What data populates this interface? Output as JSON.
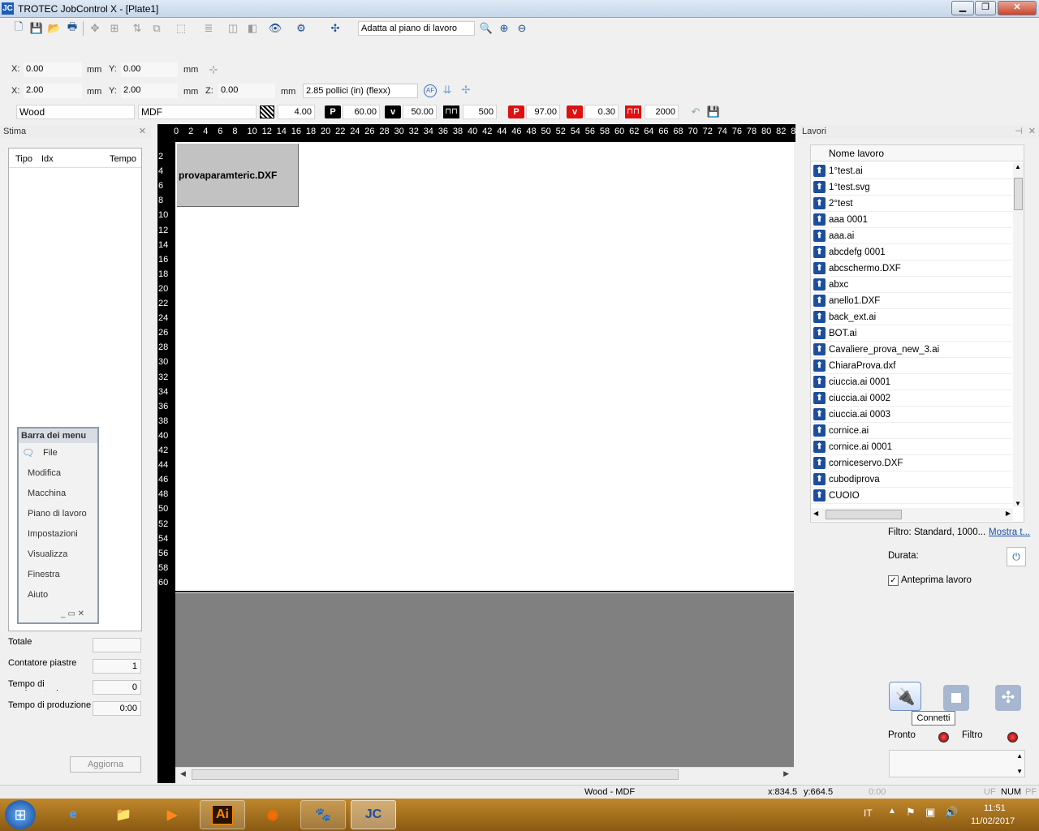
{
  "window": {
    "title": "TROTEC JobControl X - [Plate1]",
    "app_icon": "JC"
  },
  "toolbar1": {
    "zoom_mode": "Adatta al piano di lavoro"
  },
  "coords1": {
    "x_label": "X:",
    "x_value": "0.00",
    "x_unit": "mm",
    "y_label": "Y:",
    "y_value": "0.00",
    "y_unit": "mm"
  },
  "coords2": {
    "x_label": "X:",
    "x_value": "2.00",
    "x_unit": "mm",
    "y_label": "Y:",
    "y_value": "2.00",
    "y_unit": "mm",
    "z_label": "Z:",
    "z_value": "0.00",
    "z_unit": "mm",
    "lens": "2.85 pollici (in) (flexx)",
    "af_label": "AF"
  },
  "material": {
    "category": "Wood",
    "material": "MDF",
    "thickness": "4.00",
    "engrave_power_label": "P",
    "engrave_power": "60.00",
    "engrave_speed_label": "v",
    "engrave_speed": "50.00",
    "engrave_freq": "500",
    "cut_power_label": "P",
    "cut_power": "97.00",
    "cut_speed_label": "v",
    "cut_speed": "0.30",
    "cut_freq": "2000"
  },
  "estimate": {
    "title": "Stima",
    "col_type": "Tipo",
    "col_idx": "Idx",
    "col_time": "Tempo"
  },
  "menubar": {
    "title": "Barra dei menu",
    "items": [
      "File",
      "Modifica",
      "Macchina",
      "Piano di lavoro",
      "Impostazioni",
      "Visualizza",
      "Finestra",
      "Aiuto"
    ]
  },
  "summary": {
    "total_label": "Totale",
    "total_value": "",
    "plate_counter_label": "Contatore piastre",
    "plate_counter_value": "1",
    "movement_time_label": "Tempo di movimentazione",
    "movement_time_value": "0",
    "production_time_label": "Tempo di produzione",
    "production_time_value": "0:00",
    "update_button": "Aggiorna"
  },
  "ruler": {
    "top": [
      "0",
      "2",
      "4",
      "6",
      "8",
      "10",
      "12",
      "14",
      "16",
      "18",
      "20",
      "22",
      "24",
      "26",
      "28",
      "30",
      "32",
      "34",
      "36",
      "38",
      "40",
      "42",
      "44",
      "46",
      "48",
      "50",
      "52",
      "54",
      "56",
      "58",
      "60",
      "62",
      "64",
      "66",
      "68",
      "70",
      "72",
      "74",
      "76",
      "78",
      "80",
      "82",
      "8"
    ],
    "left": [
      "2",
      "4",
      "6",
      "8",
      "10",
      "12",
      "14",
      "16",
      "18",
      "20",
      "22",
      "24",
      "26",
      "28",
      "30",
      "32",
      "34",
      "36",
      "38",
      "40",
      "42",
      "44",
      "46",
      "48",
      "50",
      "52",
      "54",
      "56",
      "58",
      "60"
    ]
  },
  "canvas": {
    "job_label": "provaparamteric.DXF"
  },
  "jobs": {
    "title": "Lavori",
    "col_name": "Nome lavoro",
    "items": [
      "1°test.ai",
      "1°test.svg",
      "2°test",
      "aaa 0001",
      "aaa.ai",
      "abcdefg 0001",
      "abcschermo.DXF",
      "abxc",
      "anello1.DXF",
      "back_ext.ai",
      "BOT.ai",
      "Cavaliere_prova_new_3.ai",
      "ChiaraProva.dxf",
      "ciuccia.ai 0001",
      "ciuccia.ai 0002",
      "ciuccia.ai 0003",
      "cornice.ai",
      "cornice.ai 0001",
      "corniceservo.DXF",
      "cubodiprova",
      "CUOIO"
    ],
    "filter_text": "Filtro: Standard, 1000...",
    "show_link": "Mostra t...",
    "duration_label": "Durata:",
    "preview_label": "Anteprima lavoro",
    "preview_checked": true
  },
  "machine": {
    "connect_tooltip": "Connetti",
    "ready_label": "Pronto",
    "filter_label": "Filtro"
  },
  "status": {
    "material": "Wood - MDF",
    "x": "x:834.5",
    "y": "y:664.5",
    "time": "0:00",
    "uf": "UF",
    "num": "NUM",
    "pf": "PF"
  },
  "taskbar": {
    "lang": "IT",
    "time": "11:51",
    "date": "11/02/2017"
  }
}
